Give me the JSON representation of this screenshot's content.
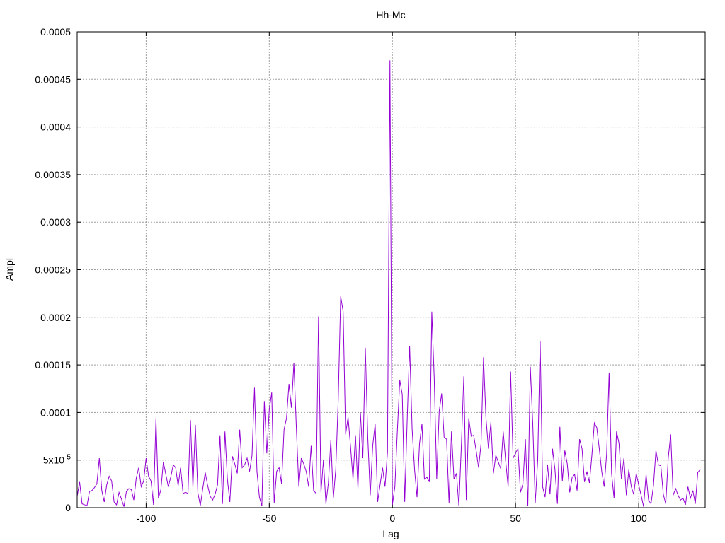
{
  "chart_data": {
    "type": "line",
    "title": "Hh-Mc",
    "xlabel": "Lag",
    "ylabel": "Ampl",
    "xlim": [
      -128,
      127
    ],
    "ylim": [
      0,
      0.0005
    ],
    "xticks": [
      {
        "value": -100,
        "label": "-100"
      },
      {
        "value": -50,
        "label": "-50"
      },
      {
        "value": 0,
        "label": "0"
      },
      {
        "value": 50,
        "label": "50"
      },
      {
        "value": 100,
        "label": "100"
      }
    ],
    "yticks": [
      {
        "value": 0,
        "label": "0"
      },
      {
        "value": 5e-05,
        "label": "5x10",
        "sup": "-5"
      },
      {
        "value": 0.0001,
        "label": "0.0001"
      },
      {
        "value": 0.00015,
        "label": "0.00015"
      },
      {
        "value": 0.0002,
        "label": "0.0002"
      },
      {
        "value": 0.00025,
        "label": "0.00025"
      },
      {
        "value": 0.0003,
        "label": "0.0003"
      },
      {
        "value": 0.00035,
        "label": "0.00035"
      },
      {
        "value": 0.0004,
        "label": "0.0004"
      },
      {
        "value": 0.00045,
        "label": "0.00045"
      },
      {
        "value": 0.0005,
        "label": "0.0005"
      }
    ],
    "grid": true,
    "line_color": "#9400d3",
    "x_start": -128,
    "x_step": 1,
    "series": [
      {
        "values": [
          1.2e-05,
          2.7e-05,
          4e-06,
          3e-06,
          2e-06,
          1.7e-05,
          1.8e-05,
          2.1e-05,
          2.5e-05,
          5.2e-05,
          1.8e-05,
          6e-06,
          2.4e-05,
          3.3e-05,
          2.8e-05,
          6e-06,
          3e-06,
          1.6e-05,
          9e-06,
          1e-06,
          1.7e-05,
          2e-05,
          1.9e-05,
          8e-06,
          3.1e-05,
          4.2e-05,
          2.2e-05,
          2.8e-05,
          5.2e-05,
          3.3e-05,
          2.8e-05,
          3e-06,
          9.4e-05,
          1e-05,
          1.9e-05,
          4.8e-05,
          3.5e-05,
          2.2e-05,
          3.2e-05,
          4.5e-05,
          4.2e-05,
          2.3e-05,
          4.2e-05,
          1.5e-05,
          1.6e-05,
          1.5e-05,
          9.2e-05,
          2.1e-05,
          8.7e-05,
          1.6e-05,
          2e-06,
          2e-05,
          3.7e-05,
          2.3e-05,
          1.2e-05,
          8e-06,
          1.4e-05,
          2.4e-05,
          7.6e-05,
          4e-06,
          8e-05,
          3e-05,
          6e-06,
          5.4e-05,
          4.6e-05,
          3.6e-05,
          8.2e-05,
          4.2e-05,
          4.5e-05,
          5.2e-05,
          3.8e-05,
          5.5e-05,
          0.000126,
          3.8e-05,
          1.1e-05,
          2e-06,
          0.000112,
          5.7e-05,
          0.000103,
          0.000121,
          5e-06,
          3.8e-05,
          4.2e-05,
          2.5e-05,
          8.2e-05,
          9.4e-05,
          0.00013,
          0.000105,
          0.000152,
          8.4e-05,
          2.2e-05,
          5.2e-05,
          4.6e-05,
          3.8e-05,
          2.2e-05,
          6.5e-05,
          1.8e-05,
          1.5e-05,
          0.000201,
          1.6e-05,
          5e-05,
          4e-06,
          2.6e-05,
          7.1e-05,
          1e-05,
          4e-05,
          0.000113,
          0.000222,
          0.000206,
          7.7e-05,
          9.5e-05,
          6.4e-05,
          3e-05,
          7.6e-05,
          2e-05,
          0.0001,
          5.2e-05,
          0.000168,
          7.4e-05,
          1.3e-05,
          6.5e-05,
          8.8e-05,
          6e-06,
          2.4e-05,
          4.2e-05,
          2.2e-05,
          5.8e-05,
          0.00047,
          3e-06,
          2.2e-05,
          8e-05,
          0.000134,
          0.000119,
          6e-06,
          9.2e-05,
          0.00017,
          8.3e-05,
          4e-05,
          1.1e-05,
          6.7e-05,
          8.8e-05,
          3e-05,
          3.2e-05,
          2.7e-05,
          0.000206,
          0.000135,
          3e-05,
          0.000101,
          0.00012,
          7.4e-05,
          7.2e-05,
          5e-06,
          8e-05,
          3e-05,
          3.6e-05,
          2e-06,
          6.5e-05,
          0.000138,
          8e-06,
          9.4e-05,
          7.5e-05,
          7.6e-05,
          6e-05,
          4.2e-05,
          6.7e-05,
          0.000158,
          9.4e-05,
          6.2e-05,
          9e-05,
          3.6e-05,
          5.5e-05,
          4.8e-05,
          4.1e-05,
          8e-05,
          4.9e-05,
          2.2e-05,
          0.000143,
          5.2e-05,
          5.7e-05,
          6.2e-05,
          1.6e-05,
          2.5e-05,
          7.2e-05,
          2e-06,
          0.000148,
          8.8e-05,
          5e-06,
          5e-05,
          0.000175,
          2.2e-05,
          1.1e-05,
          4.5e-05,
          1.4e-05,
          6.2e-05,
          4e-05,
          4e-06,
          8.5e-05,
          2.8e-05,
          6e-05,
          4.6e-05,
          1.6e-05,
          3.2e-05,
          3.5e-05,
          1.8e-05,
          7.2e-05,
          6.2e-05,
          2.7e-05,
          3.8e-05,
          2.6e-05,
          5.5e-05,
          8.9e-05,
          8.4e-05,
          6.2e-05,
          3.8e-05,
          2.2e-05,
          5.7e-05,
          0.000142,
          3.6e-05,
          1e-05,
          8e-05,
          6.8e-05,
          3e-05,
          5.2e-05,
          1.3e-05,
          4e-05,
          2.2e-05,
          1.4e-05,
          3.6e-05,
          2.4e-05,
          1.3e-05,
          1e-06,
          3.5e-05,
          8e-06,
          4e-06,
          2.3e-05,
          6e-05,
          4.5e-05,
          4.4e-05,
          1.4e-05,
          4e-06,
          5.2e-05,
          7.7e-05,
          1.3e-05,
          2e-05,
          1.3e-05,
          8e-06,
          1e-05,
          3e-06,
          2.2e-05,
          1e-05,
          1.8e-05,
          4e-06,
          3.7e-05,
          4e-05
        ]
      }
    ]
  }
}
